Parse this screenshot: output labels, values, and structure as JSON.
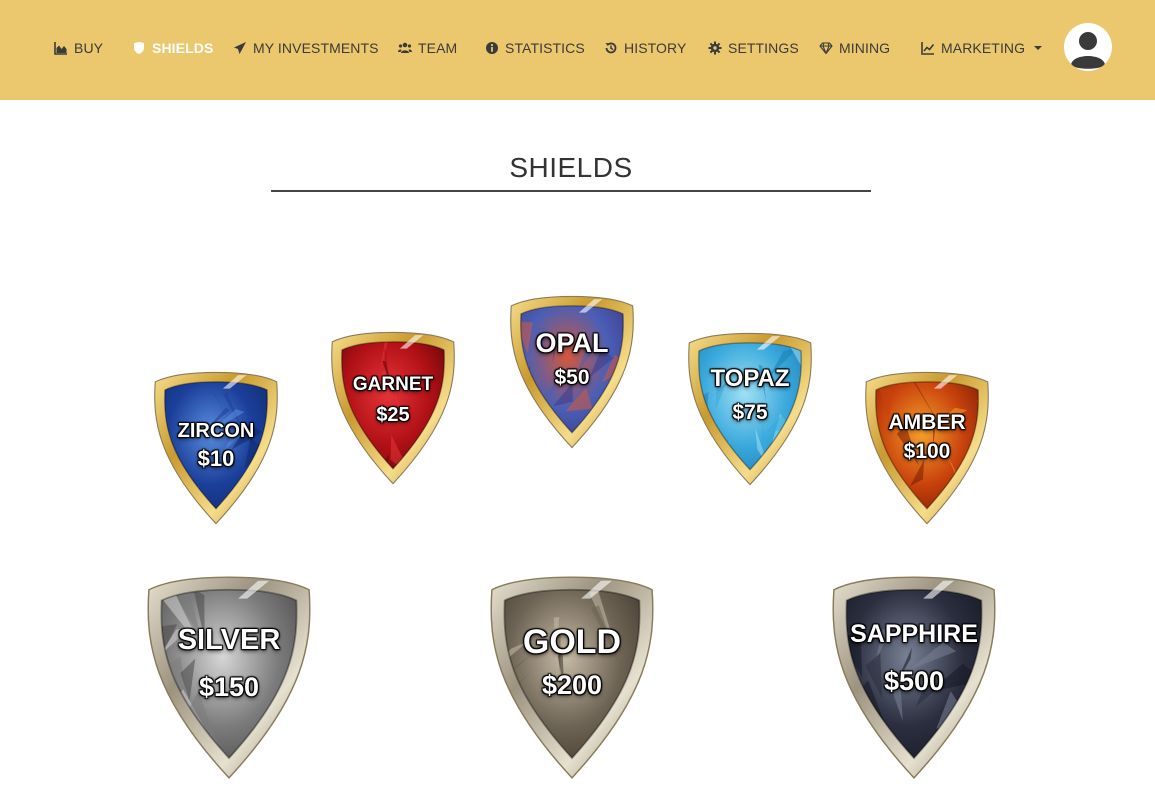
{
  "nav": {
    "items": [
      {
        "label": "BUY",
        "icon": "area-chart-icon"
      },
      {
        "label": "SHIELDS",
        "icon": "shield-icon"
      },
      {
        "label": "MY INVESTMENTS",
        "icon": "paper-plane-icon"
      },
      {
        "label": "TEAM",
        "icon": "users-icon"
      },
      {
        "label": "STATISTICS",
        "icon": "info-circle-icon"
      },
      {
        "label": "HISTORY",
        "icon": "history-icon"
      },
      {
        "label": "SETTINGS",
        "icon": "gear-icon"
      },
      {
        "label": "MINING",
        "icon": "diamond-icon"
      },
      {
        "label": "MARKETING",
        "icon": "line-chart-icon"
      }
    ],
    "active": "SHIELDS",
    "colors": {
      "bar": "#ebc76d",
      "text": "#3b3b3b",
      "active_text": "#ffffff"
    }
  },
  "page": {
    "title": "SHIELDS"
  },
  "shields": [
    {
      "name": "ZIRCON",
      "price": "$10",
      "colors": [
        "#1b3f9a",
        "#5a8ee0",
        "#0f2a6e"
      ]
    },
    {
      "name": "GARNET",
      "price": "$25",
      "colors": [
        "#b01116",
        "#e8343a",
        "#5e0608"
      ]
    },
    {
      "name": "OPAL",
      "price": "$50",
      "colors": [
        "#4a5fb5",
        "#d5573a",
        "#3c3a8a"
      ]
    },
    {
      "name": "TOPAZ",
      "price": "$75",
      "colors": [
        "#3aa9dc",
        "#9fe0f5",
        "#1a7fb8"
      ]
    },
    {
      "name": "AMBER",
      "price": "$100",
      "colors": [
        "#c8420d",
        "#f6a02a",
        "#7a1d04"
      ]
    },
    {
      "name": "SILVER",
      "price": "$150",
      "colors": [
        "#7c7c7c",
        "#d6d6d6",
        "#4a4a4a"
      ]
    },
    {
      "name": "GOLD",
      "price": "$200",
      "colors": [
        "#6e6455",
        "#c7bba6",
        "#3f372c"
      ]
    },
    {
      "name": "SAPPHIRE",
      "price": "$500",
      "colors": [
        "#2a2e3e",
        "#7a8196",
        "#151823"
      ]
    }
  ],
  "frame_colors": {
    "gem": [
      "#c99a2e",
      "#f6dd8a",
      "#a87820"
    ],
    "metal": [
      "#9c937f",
      "#e6e0cf",
      "#7a7262"
    ]
  }
}
